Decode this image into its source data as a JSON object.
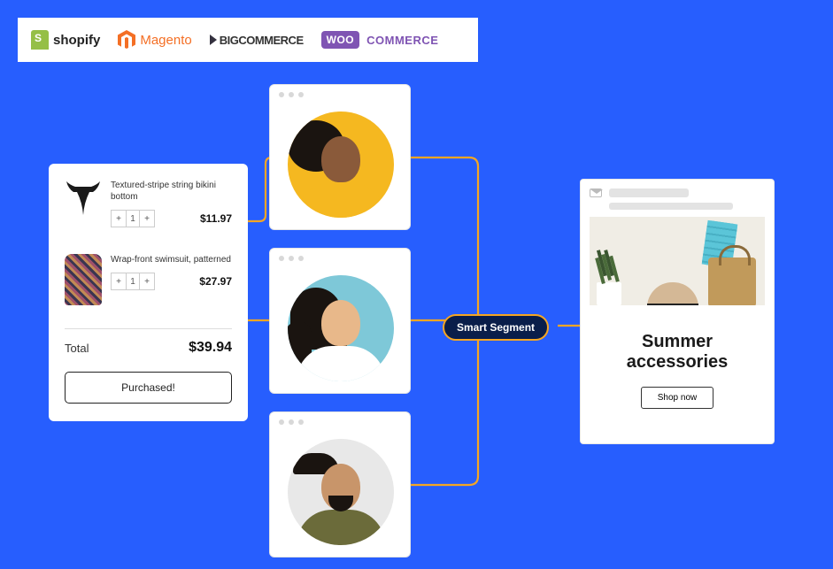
{
  "platforms": {
    "shopify": "shopify",
    "magento": "Magento",
    "bigcommerce_big": "BIG",
    "bigcommerce_commerce": "COMMERCE",
    "woo_badge": "WOO",
    "woo_commerce": "COMMERCE"
  },
  "cart": {
    "items": [
      {
        "name": "Textured-stripe string bikini bottom",
        "qty": "1",
        "price": "$11.97"
      },
      {
        "name": "Wrap-front swimsuit, patterned",
        "qty": "1",
        "price": "$27.97"
      }
    ],
    "qty_minus": "+",
    "qty_plus": "+",
    "total_label": "Total",
    "total_value": "$39.94",
    "cta": "Purchased!"
  },
  "segment_label": "Smart Segment",
  "email": {
    "title_line1": "Summer",
    "title_line2": "accessories",
    "cta": "Shop now"
  }
}
